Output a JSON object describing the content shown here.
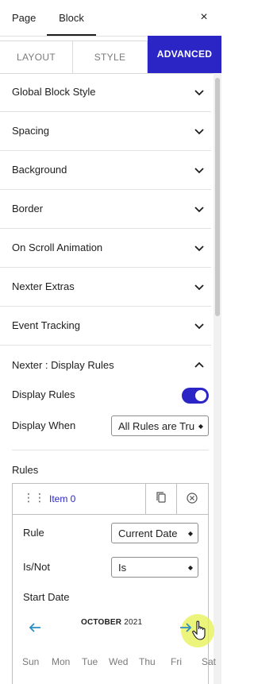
{
  "top_tabs": [
    "Page",
    "Block"
  ],
  "close_icon": "×",
  "sub_tabs": [
    "LAYOUT",
    "STYLE",
    "ADVANCED"
  ],
  "panels": [
    "Global Block Style",
    "Spacing",
    "Background",
    "Border",
    "On Scroll Animation",
    "Nexter Extras",
    "Event Tracking",
    "Nexter : Display Rules"
  ],
  "display_rules": {
    "toggle_label": "Display Rules",
    "toggle_on": true,
    "when_label": "Display When",
    "when_value": "All Rules are Tru",
    "rules_label": "Rules",
    "item": {
      "title": "Item 0",
      "rule_label": "Rule",
      "rule_value": "Current Date",
      "isnot_label": "Is/Not",
      "isnot_value": "Is",
      "start_label": "Start Date",
      "month": "OCTOBER",
      "year": "2021",
      "weekdays": [
        "Sun",
        "Mon",
        "Tue",
        "Wed",
        "Thu",
        "Fri",
        "Sat"
      ]
    }
  },
  "colors": {
    "accent": "#2b25c6",
    "arrow": "#2b8fc6"
  }
}
